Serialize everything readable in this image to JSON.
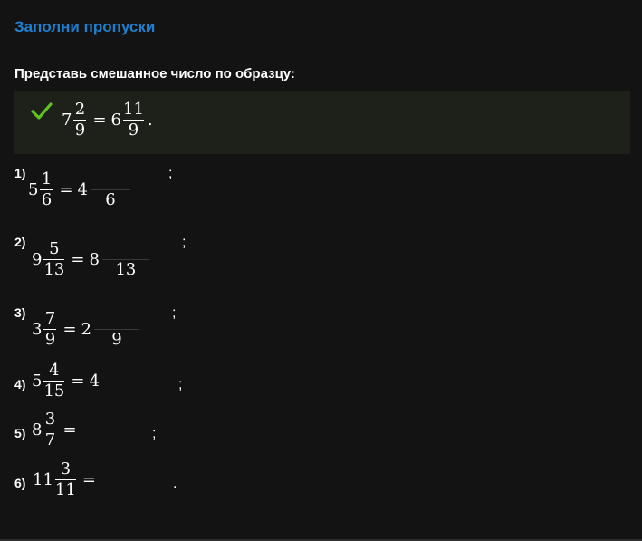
{
  "header": {
    "title": "Заполни пропуски"
  },
  "task": {
    "prompt": "Представь смешанное число по образцу:"
  },
  "example": {
    "whole": "7",
    "num": "2",
    "den": "9",
    "eq": "=",
    "res_whole": "6",
    "res_num": "11",
    "res_den": "9",
    "end": "."
  },
  "items": [
    {
      "label": "1)",
      "whole": "5",
      "num": "1",
      "den": "6",
      "eq": "=",
      "res_whole": "4",
      "res_den": "6",
      "punct": ";"
    },
    {
      "label": "2)",
      "whole": "9",
      "num": "5",
      "den": "13",
      "eq": "=",
      "res_whole": "8",
      "res_den": "13",
      "punct": ";"
    },
    {
      "label": "3)",
      "whole": "3",
      "num": "7",
      "den": "9",
      "eq": "=",
      "res_whole": "2",
      "res_den": "9",
      "punct": ";"
    },
    {
      "label": "4)",
      "whole": "5",
      "num": "4",
      "den": "15",
      "eq": "=",
      "res_whole": "4",
      "punct": ";"
    },
    {
      "label": "5)",
      "whole": "8",
      "num": "3",
      "den": "7",
      "eq": "=",
      "punct": ";"
    },
    {
      "label": "6)",
      "whole": "11",
      "num": "3",
      "den": "11",
      "eq": "=",
      "punct": "."
    }
  ],
  "colors": {
    "title": "#1f7fd0",
    "check": "#5fc41f",
    "example_bg": "#1d211a",
    "background": "#131313"
  }
}
